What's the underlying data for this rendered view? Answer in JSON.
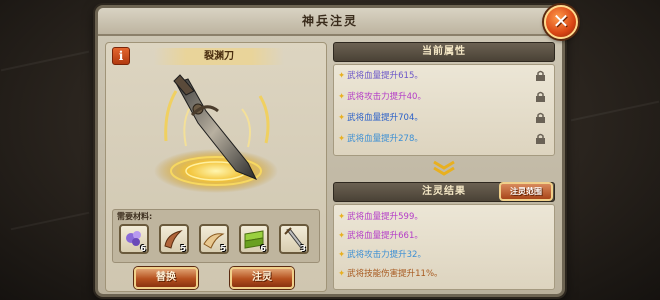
{
  "dialog": {
    "title": "神兵注灵",
    "close_label": "✕"
  },
  "left": {
    "info_label": "i",
    "item_name": "裂渊刀",
    "materials_label": "需要材料:",
    "materials": [
      {
        "icon": "purple-crystal-icon",
        "count": "6"
      },
      {
        "icon": "horn-icon",
        "count": "5"
      },
      {
        "icon": "tusk-icon",
        "count": "5"
      },
      {
        "icon": "green-bar-icon",
        "count": "6"
      },
      {
        "icon": "sword-icon",
        "count": "3"
      }
    ],
    "replace_button": "替换",
    "infuse_button": "注灵"
  },
  "right": {
    "current_header": "当前属性",
    "current_attrs": [
      {
        "text": "武将血量提升615。",
        "color": "#6a55c8"
      },
      {
        "text": "武将攻击力提升40。",
        "color": "#b43cc8"
      },
      {
        "text": "武将血量提升704。",
        "color": "#2a5fc8"
      },
      {
        "text": "武将血量提升278。",
        "color": "#3c8fd4"
      }
    ],
    "result_header": "注灵结果",
    "preview_button": "注灵范围",
    "result_attrs": [
      {
        "text": "武将血量提升599。",
        "color": "#b43cc8"
      },
      {
        "text": "武将血量提升661。",
        "color": "#b43cc8"
      },
      {
        "text": "武将攻击力提升32。",
        "color": "#3c8fd4"
      },
      {
        "text": "武将技能伤害提升11%。",
        "color": "#a85a20"
      }
    ]
  }
}
